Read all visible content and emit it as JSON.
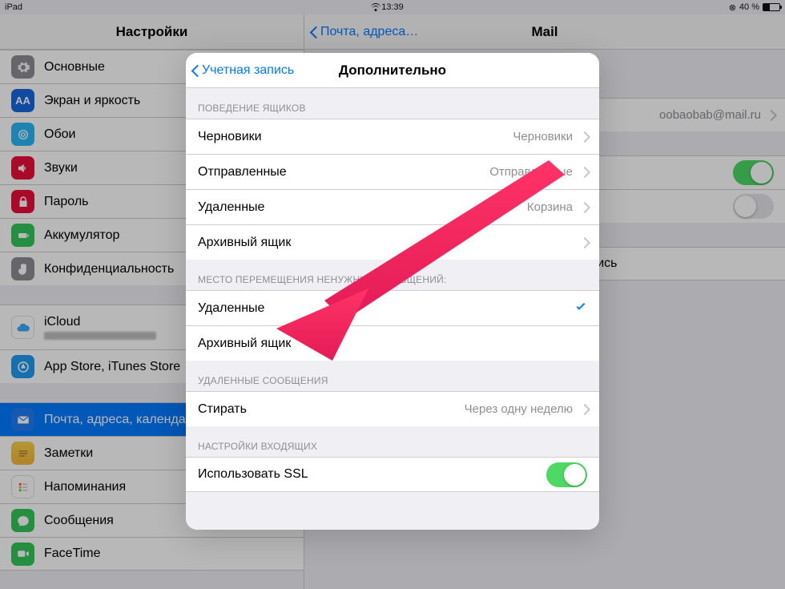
{
  "status": {
    "device": "iPad",
    "time": "13:39",
    "battery_pct": "40 %"
  },
  "sidebar": {
    "title": "Настройки",
    "group1": [
      {
        "icon": "gear",
        "bg": "#8E8E93",
        "label": "Основные"
      },
      {
        "icon": "Aa",
        "bg": "#1769E0",
        "label": "Экран и яркость"
      },
      {
        "icon": "flower",
        "bg": "#29B7F6",
        "label": "Обои"
      },
      {
        "icon": "speaker",
        "bg": "#EC0E39",
        "label": "Звуки"
      },
      {
        "icon": "lock",
        "bg": "#EC0E39",
        "label": "Пароль"
      },
      {
        "icon": "battery",
        "bg": "#33C759",
        "label": "Аккумулятор"
      },
      {
        "icon": "hand",
        "bg": "#8E8E93",
        "label": "Конфиденциальность"
      }
    ],
    "group2": [
      {
        "icon": "cloud",
        "bg": "#FFFFFF",
        "label": "iCloud"
      },
      {
        "icon": "appstore",
        "bg": "#1F9CF0",
        "label": "App Store, iTunes Store"
      }
    ],
    "group3": [
      {
        "icon": "mail",
        "bg": "#1F7CF6",
        "label": "Почта, адреса, календари"
      },
      {
        "icon": "notes",
        "bg": "#F7D24A",
        "label": "Заметки"
      },
      {
        "icon": "reminders",
        "bg": "#FFFFFF",
        "label": "Напоминания"
      },
      {
        "icon": "messages",
        "bg": "#33C759",
        "label": "Сообщения"
      },
      {
        "icon": "facetime",
        "bg": "#33C759",
        "label": "FaceTime"
      }
    ]
  },
  "detail": {
    "back_label": "Почта, адреса…",
    "title": "Mail",
    "account_value": "oobaobab@mail.ru",
    "delete_label": "Удалить учетную запись"
  },
  "modal": {
    "back_label": "Учетная запись",
    "title": "Дополнительно",
    "sections": {
      "mailbox_behavior": {
        "header": "Поведение ящиков",
        "rows": [
          {
            "label": "Черновики",
            "value": "Черновики"
          },
          {
            "label": "Отправленные",
            "value": "Отправленные"
          },
          {
            "label": "Удаленные",
            "value": "Корзина"
          },
          {
            "label": "Архивный ящик",
            "value": ""
          }
        ]
      },
      "move_discarded": {
        "header": "Место перемещения ненужных сообщений:",
        "rows": [
          {
            "label": "Удаленные",
            "checked": true
          },
          {
            "label": "Архивный ящик",
            "checked": false
          }
        ]
      },
      "deleted": {
        "header": "Удаленные сообщения",
        "rows": [
          {
            "label": "Стирать",
            "value": "Через одну неделю"
          }
        ]
      },
      "incoming": {
        "header": "Настройки входящих",
        "rows": [
          {
            "label": "Использовать SSL",
            "switch": true
          }
        ]
      }
    }
  }
}
